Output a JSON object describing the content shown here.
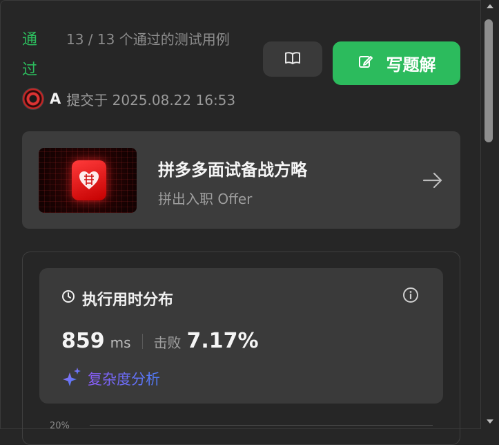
{
  "header": {
    "status": "通过",
    "testcases": "13 / 13 个通过的测试用例",
    "write_solution_label": "写题解"
  },
  "submission": {
    "user": "A",
    "submitted_text": "提交于 2025.08.22 16:53"
  },
  "promo": {
    "title": "拼多多面试备战方略",
    "subtitle": "拼出入职 Offer"
  },
  "stats": {
    "title": "执行用时分布",
    "runtime_value": "859",
    "runtime_unit": "ms",
    "beats_label": "击败",
    "beats_value": "7.17%",
    "complexity_label": "复杂度分析",
    "axis_tick": "20%"
  },
  "colors": {
    "accent_green": "#2cbb5d",
    "background": "#262626",
    "card": "#3a3a3a"
  },
  "icons": {
    "book": "book-icon",
    "edit": "edit-icon",
    "arrow": "arrow-right-icon",
    "clock": "clock-icon",
    "info": "info-icon",
    "sparkle": "sparkle-icon"
  }
}
